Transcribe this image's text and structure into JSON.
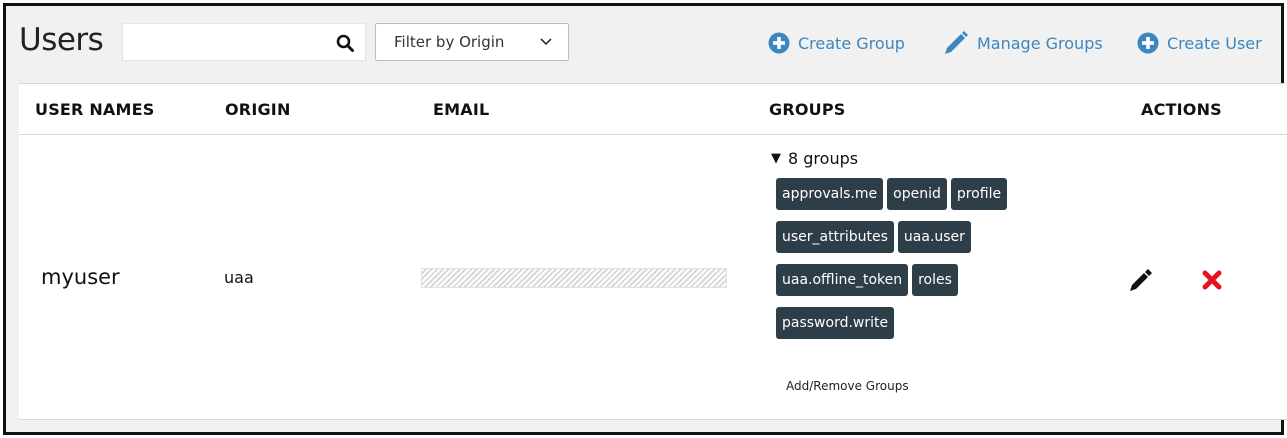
{
  "header": {
    "title": "Users",
    "search": {
      "value": "",
      "placeholder": ""
    },
    "filter": {
      "selected": "Filter by Origin"
    },
    "actions": {
      "create_group": "Create Group",
      "manage_groups": "Manage Groups",
      "create_user": "Create User"
    },
    "icons": {
      "search": "search-icon",
      "chevron": "chevron-down-icon",
      "plus": "plus-circle-icon",
      "pencil": "pencil-icon"
    },
    "accent_color": "#3b87bf"
  },
  "table": {
    "columns": [
      "USER NAMES",
      "ORIGIN",
      "EMAIL",
      "GROUPS",
      "ACTIONS"
    ],
    "rows": [
      {
        "name": "myuser",
        "origin": "uaa",
        "email_redacted": true,
        "groups_summary": "8 groups",
        "groups": [
          [
            "approvals.me",
            "openid",
            "profile"
          ],
          [
            "user_attributes",
            "uaa.user"
          ],
          [
            "uaa.offline_token",
            "roles"
          ],
          [
            "password.write"
          ]
        ],
        "add_remove_label": "Add/Remove Groups",
        "actions": {
          "edit_icon": "pencil-icon",
          "delete_icon": "delete-x-icon"
        }
      }
    ]
  },
  "colors": {
    "tag_bg": "#2d3e48",
    "delete": "#e8121a"
  }
}
